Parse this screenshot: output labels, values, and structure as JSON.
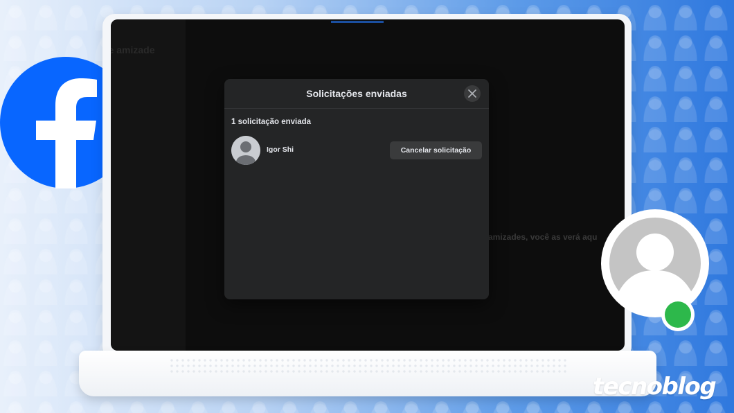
{
  "background_screen": {
    "title_fragment": "de amizade",
    "empty_text_fragment": "amizades, você as verá aqu"
  },
  "dialog": {
    "title": "Solicitações enviadas",
    "close_icon": "close-icon",
    "count_label": "1 solicitação enviada",
    "requests": [
      {
        "name": "Igor Shi",
        "action_label": "Cancelar solicitação",
        "avatar_icon": "default-avatar-icon"
      }
    ]
  },
  "branding": {
    "watermark": "tecnoblog",
    "logo_icon": "facebook-logo-icon",
    "badge_icon": "profile-online-badge-icon"
  },
  "colors": {
    "dialog_bg": "#242526",
    "button_bg": "#3a3b3c",
    "text": "#e4e6eb",
    "facebook_blue": "#0866ff",
    "online_green": "#2db84b"
  }
}
